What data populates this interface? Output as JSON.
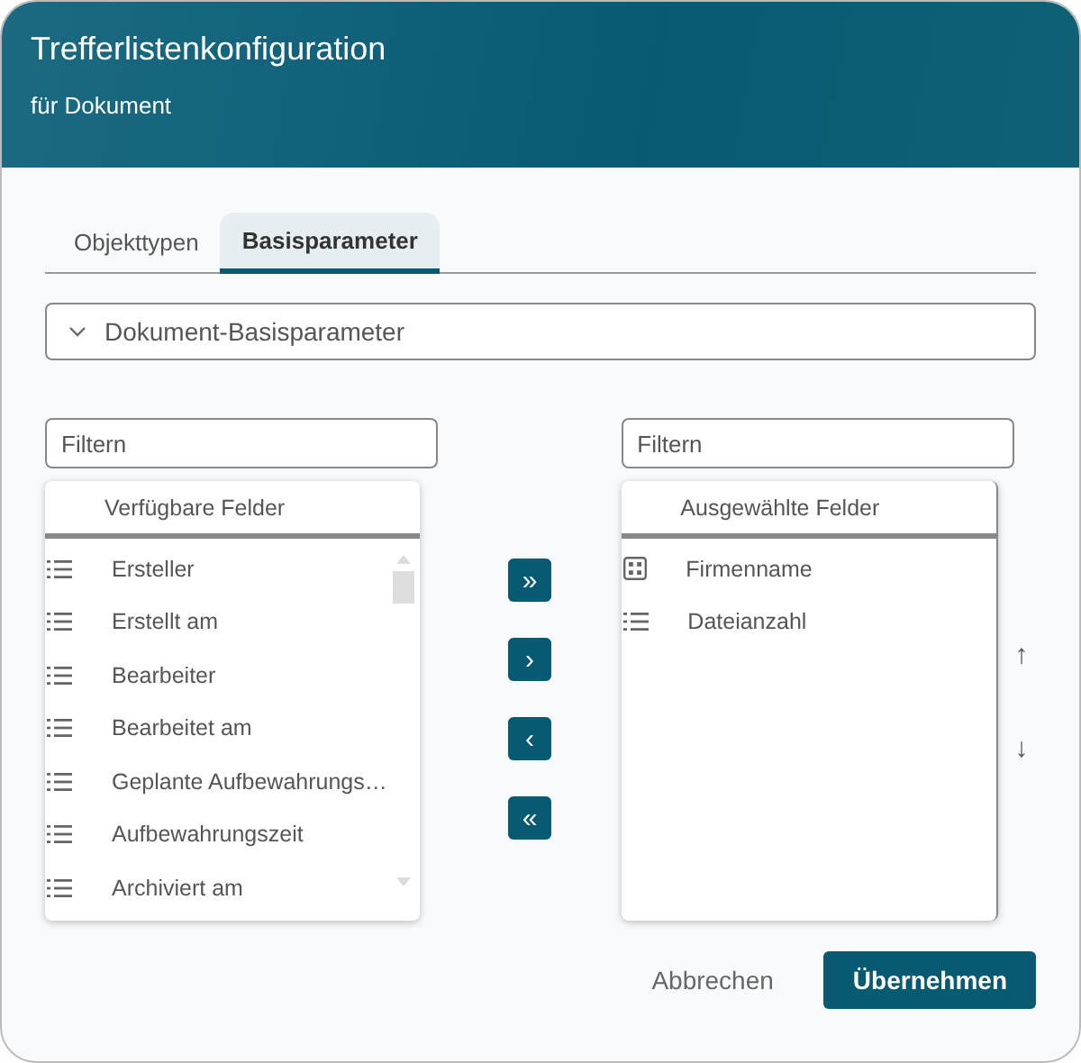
{
  "window": {
    "title": "Trefferlistenkonfiguration",
    "subtitle": "für Dokument"
  },
  "tabs": [
    {
      "label": "Objekttypen",
      "selected": false
    },
    {
      "label": "Basisparameter",
      "selected": true
    }
  ],
  "section": {
    "label": "Dokument-Basisparameter",
    "expanded": true
  },
  "available": {
    "placeholder": "Filtern",
    "heading": "Verfügbare Felder",
    "items": [
      {
        "label": "Ersteller",
        "kind": "list"
      },
      {
        "label": "Erstellt am",
        "kind": "list"
      },
      {
        "label": "Bearbeiter",
        "kind": "list"
      },
      {
        "label": "Bearbeitet am",
        "kind": "list"
      },
      {
        "label": "Geplante Aufbewahrungs…",
        "kind": "list"
      },
      {
        "label": "Aufbewahrungszeit",
        "kind": "list"
      },
      {
        "label": "Archiviert am",
        "kind": "list"
      }
    ]
  },
  "transfer_buttons": [
    "»",
    "›",
    "‹",
    "«"
  ],
  "selected": {
    "placeholder": "Filtern",
    "heading": "Ausgewählte Felder",
    "items": [
      {
        "label": "Firmenname",
        "kind": "grid"
      },
      {
        "label": "Dateianzahl",
        "kind": "list"
      }
    ]
  },
  "order_buttons": [
    "↑",
    "↓"
  ],
  "buttons": {
    "cancel": "Abbrechen",
    "apply": "Übernehmen"
  }
}
